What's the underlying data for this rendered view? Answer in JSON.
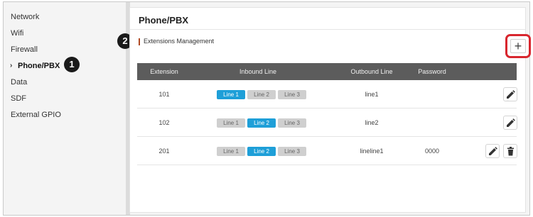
{
  "sidebar": {
    "items": [
      {
        "label": "Network"
      },
      {
        "label": "Wifi"
      },
      {
        "label": "Firewall"
      },
      {
        "label": "Phone/PBX",
        "active": true
      },
      {
        "label": "Data"
      },
      {
        "label": "SDF"
      },
      {
        "label": "External GPIO"
      }
    ]
  },
  "markers": {
    "first": "1",
    "second": "2"
  },
  "panel": {
    "title": "Phone/PBX",
    "section_title": "Extensions Management",
    "add_label": "+"
  },
  "table": {
    "headers": [
      "Extension",
      "Inbound Line",
      "Outbound Line",
      "Password"
    ],
    "rows": [
      {
        "extension": "101",
        "lines": [
          "Line 1",
          "Line 2",
          "Line 3"
        ],
        "active_line": "Line 1",
        "outbound": "line1",
        "password": "",
        "actions": [
          "edit"
        ]
      },
      {
        "extension": "102",
        "lines": [
          "Line 1",
          "Line 2",
          "Line 3"
        ],
        "active_line": "Line 2",
        "outbound": "line2",
        "password": "",
        "actions": [
          "edit"
        ]
      },
      {
        "extension": "201",
        "lines": [
          "Line 1",
          "Line 2",
          "Line 3"
        ],
        "active_line": "Line 2",
        "outbound": "lineline1",
        "password": "0000",
        "actions": [
          "edit",
          "delete"
        ]
      }
    ]
  },
  "colors": {
    "accent": "#1e9fd8",
    "highlight": "#d8262e",
    "header_bg": "#5c5c5c"
  },
  "icons": {
    "edit": "pencil-icon",
    "delete": "trash-icon",
    "add": "plus-icon",
    "chevron": "chevron-right-icon"
  }
}
